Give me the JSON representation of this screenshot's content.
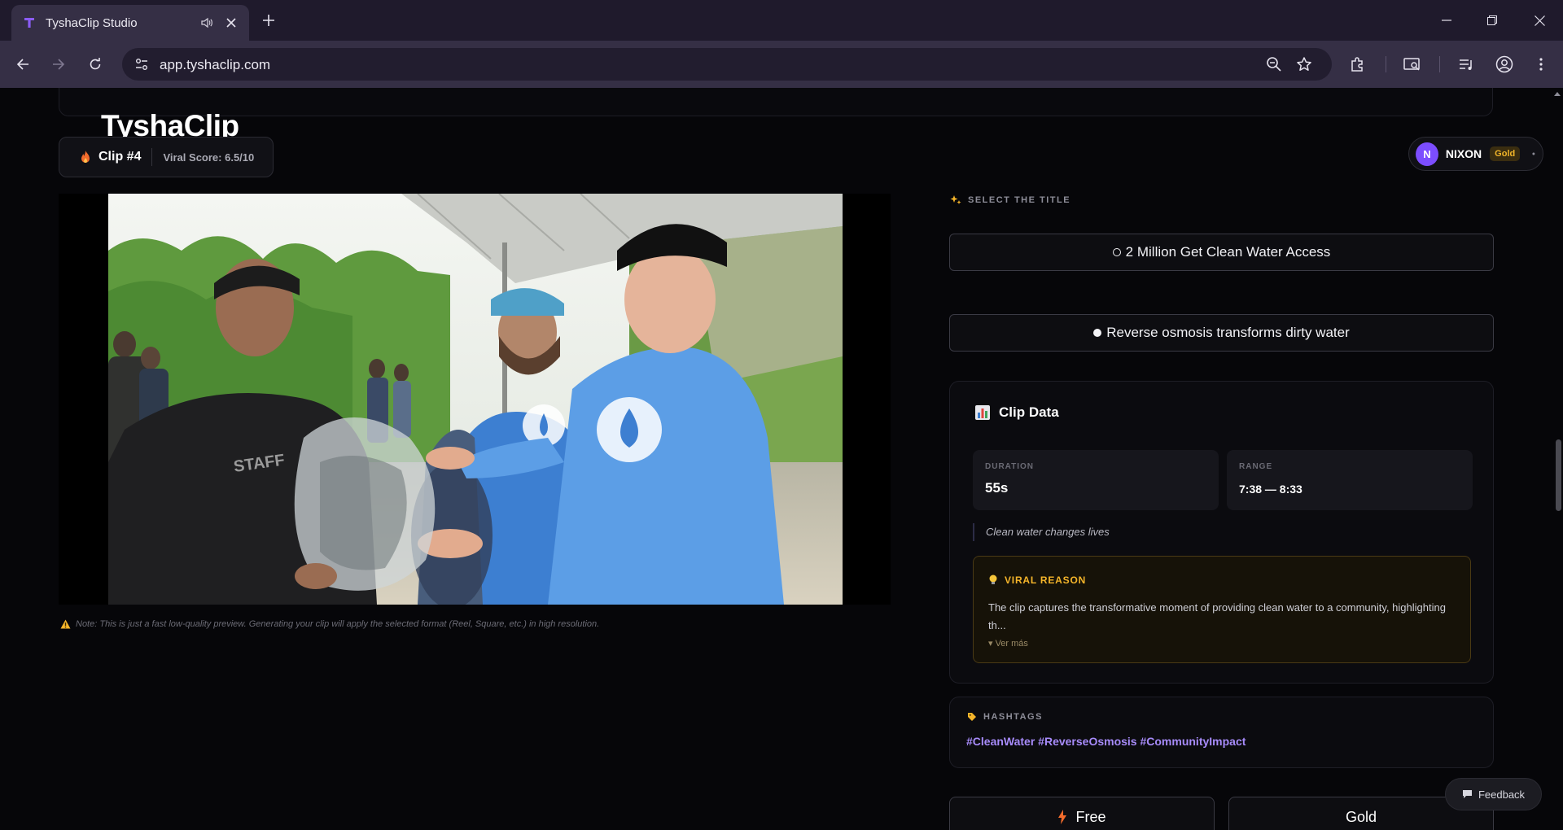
{
  "browser": {
    "tab_title": "TyshaClip Studio",
    "url": "app.tyshaclip.com"
  },
  "header": {
    "logo": "TyshaClip",
    "clip_label": "Clip #4",
    "viral_score": "Viral Score: 6.5/10"
  },
  "user": {
    "initial": "N",
    "name": "NIXON",
    "plan": "Gold"
  },
  "preview": {
    "note": "Note: This is just a fast low-quality preview. Generating your clip will apply the selected format (Reel, Square, etc.) in high resolution."
  },
  "title_select": {
    "label": "SELECT THE TITLE",
    "options": [
      {
        "text": "2 Million Get Clean Water Access",
        "selected": false
      },
      {
        "text": "Reverse osmosis transforms dirty water",
        "selected": true
      }
    ]
  },
  "clip_data": {
    "heading": "Clip Data",
    "duration_label": "DURATION",
    "duration_value": "55s",
    "range_label": "RANGE",
    "range_value": "7:38 — 8:33",
    "quote": "Clean water changes lives",
    "viral_reason": {
      "label": "VIRAL REASON",
      "text": "The clip captures the transformative moment of providing clean water to a community, highlighting th...",
      "more": "▾ Ver más"
    }
  },
  "hashtags": {
    "label": "HASHTAGS",
    "text": "#CleanWater #ReverseOsmosis #CommunityImpact"
  },
  "plans": {
    "free": "Free",
    "gold": "Gold"
  },
  "feedback_label": "Feedback",
  "colors": {
    "accent_purple": "#7c4dff",
    "hashtag_purple": "#a78bfa",
    "gold": "#f5b52a",
    "background": "#060609"
  }
}
